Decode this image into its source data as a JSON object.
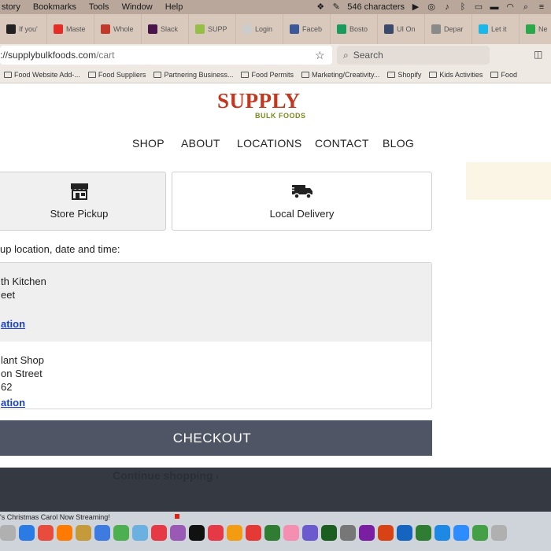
{
  "menubar": {
    "items": [
      "story",
      "Bookmarks",
      "Tools",
      "Window",
      "Help"
    ],
    "char_count": "546 characters"
  },
  "tabs": [
    {
      "label": "If you'",
      "icon": "bookmark-icon",
      "color": "#222222"
    },
    {
      "label": "Maste",
      "icon": "youtube-icon",
      "color": "#e52d27"
    },
    {
      "label": "Whole",
      "icon": "link-icon",
      "color": "#c0392b"
    },
    {
      "label": "Slack",
      "icon": "slack-icon",
      "color": "#4a154b"
    },
    {
      "label": "SUPP",
      "icon": "shopify-icon",
      "color": "#95bf47"
    },
    {
      "label": "Login",
      "icon": "blank-icon",
      "color": "#cccccc"
    },
    {
      "label": "Faceb",
      "icon": "facebook-icon",
      "color": "#3b5998"
    },
    {
      "label": "Bosto",
      "icon": "sheets-icon",
      "color": "#1a9a5c"
    },
    {
      "label": "UI On",
      "icon": "shield-icon",
      "color": "#3b4a6b"
    },
    {
      "label": "Depar",
      "icon": "seal-icon",
      "color": "#8a8a8a"
    },
    {
      "label": "Let it",
      "icon": "vimeo-icon",
      "color": "#1ab7ea"
    },
    {
      "label": "Ne",
      "icon": "chat-icon",
      "color": "#2aa84a"
    }
  ],
  "urlbar": {
    "host": "supplybulkfoods.com",
    "path": "/cart",
    "scheme_prefix": "://",
    "search_placeholder": "Search"
  },
  "bookmarks": [
    "Food Website Add-...",
    "Food Suppliers",
    "Partnering Business...",
    "Food Permits",
    "Marketing/Creativity...",
    "Shopify",
    "Kids Activities",
    "Food"
  ],
  "site": {
    "logo_word": "SUPPLY",
    "logo_sub": "BULK FOODS",
    "nav": [
      "SHOP",
      "ABOUT",
      "LOCATIONS",
      "CONTACT",
      "BLOG"
    ]
  },
  "cart": {
    "options": {
      "pickup": "Store Pickup",
      "delivery": "Local Delivery"
    },
    "prompt": "up location, date and time:",
    "locations": [
      {
        "line1": "th Kitchen",
        "line2": "eet",
        "line3": "",
        "link": "ation"
      },
      {
        "line1": "lant Shop",
        "line2": "on Street",
        "line3": "62",
        "link": "ation"
      }
    ],
    "checkout_label": "CHECKOUT",
    "continue_label": "Continue shopping"
  },
  "dock": {
    "status": "'s Christmas Carol Now Streaming!"
  }
}
